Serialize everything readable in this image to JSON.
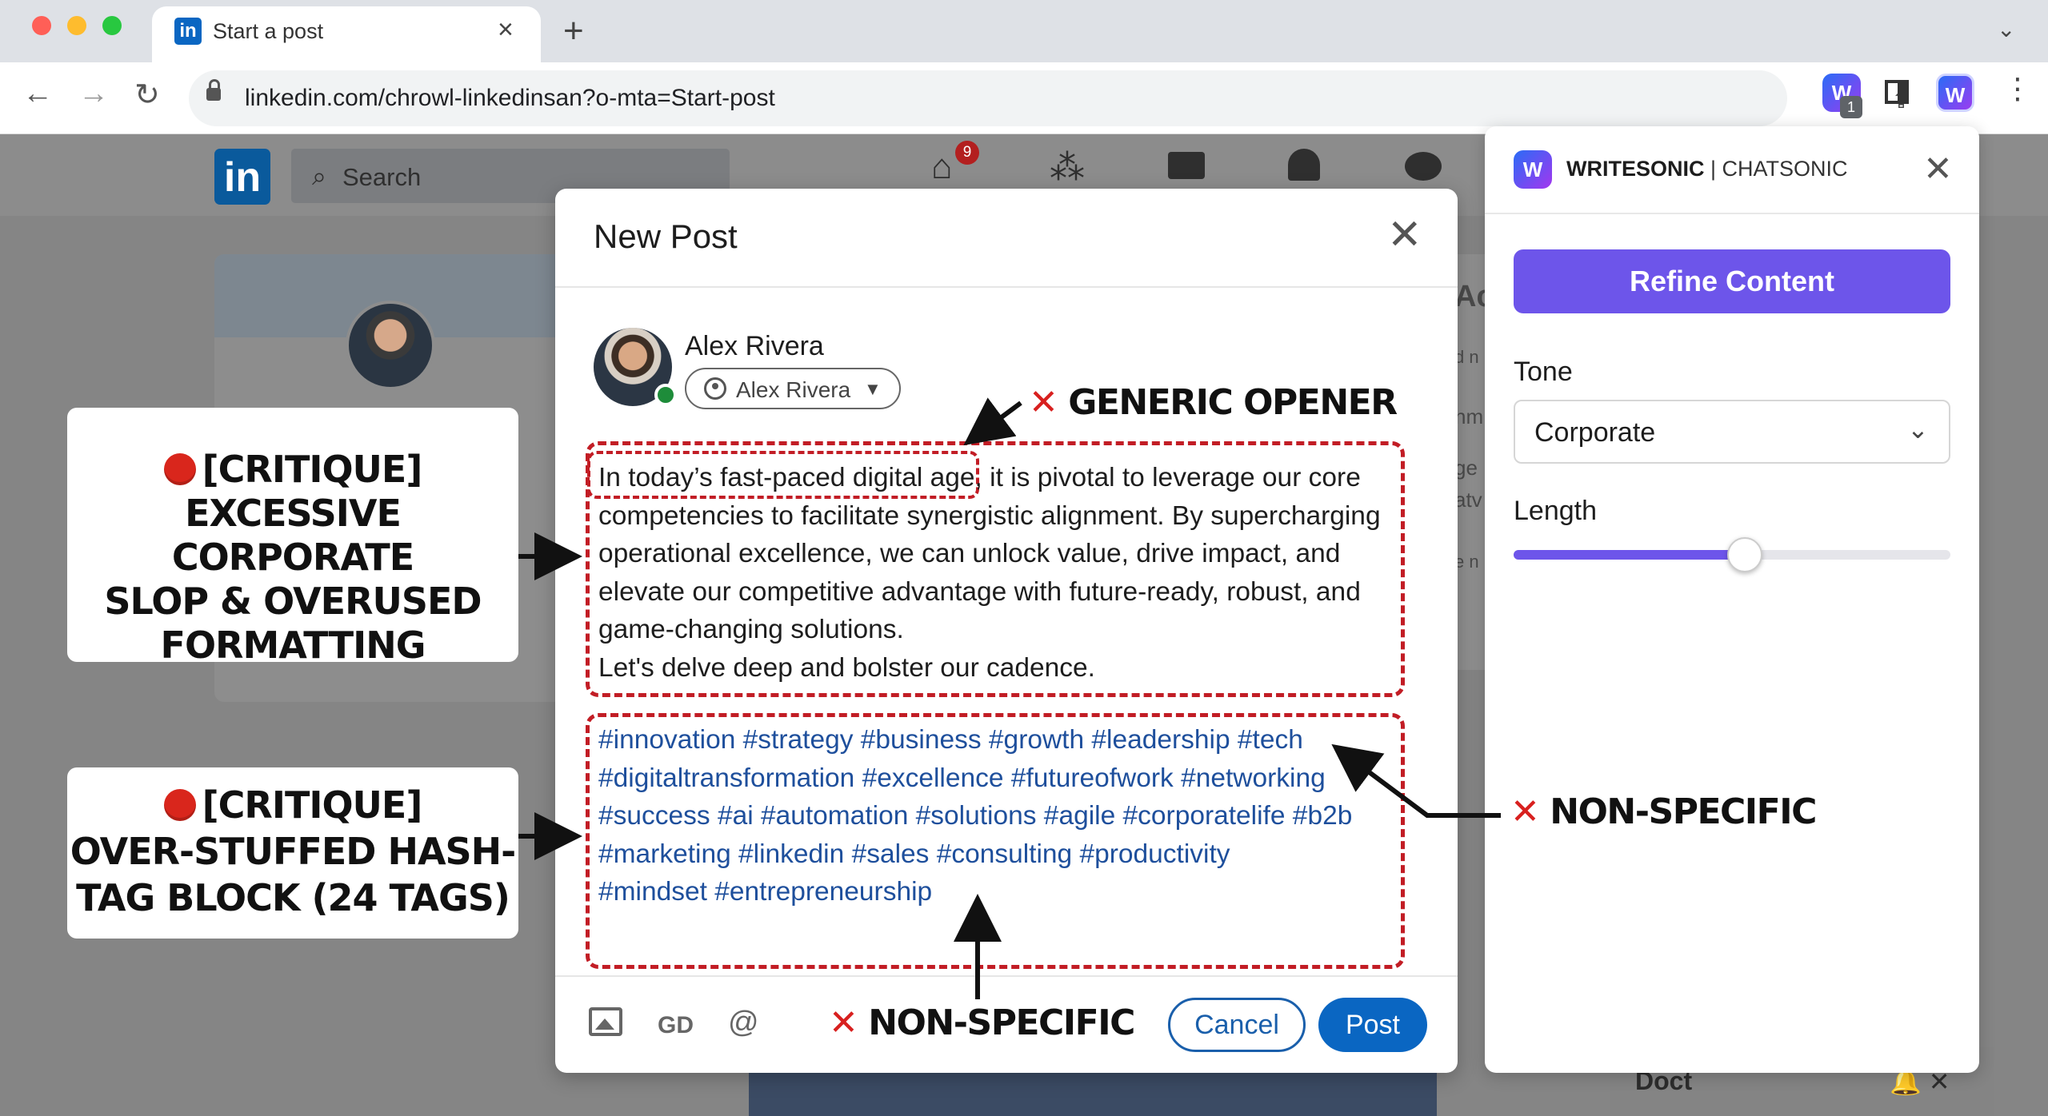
{
  "browser": {
    "tab_title": "Start a post",
    "tab_favicon_text": "in",
    "url": "linkedin.com/chrowl-linkedinsan?o-mta=Start-post",
    "extension_badge": "1",
    "window_controls": [
      "close",
      "minimize",
      "maximize"
    ],
    "colors": {
      "close": "#ff5f57",
      "minimize": "#febc2e",
      "maximize": "#28c840"
    }
  },
  "linkedin": {
    "logo_text": "in",
    "search_placeholder": "Search",
    "home_badge": "9",
    "nav_icons": [
      "home-icon",
      "my-network-icon",
      "jobs-icon",
      "notifications-icon",
      "messaging-icon"
    ],
    "bg_fragments": [
      "Ac",
      "d n",
      "nm",
      "ge",
      "atv",
      "e n"
    ],
    "messaging_title": "Doct"
  },
  "modal": {
    "title": "New Post",
    "author_name": "Alex Rivera",
    "audience_label": "Alex Rivera",
    "body_lines": [
      "In today’s fast-paced digital age, it is pivotal to leverage our core",
      "competencies to facilitate synergistic alignment. By supercharging",
      "operational excellence, we can unlock value, drive impact, and",
      "elevate our competitive advantage with future-ready, robust, and",
      "game-changing solutions.",
      "Let's delve deep and bolster our cadence."
    ],
    "hashtag_lines": [
      "#innovation #strategy #business #growth #leadership #tech",
      "#digitaltransformation #excellence #futureofwork #networking",
      "#success #ai #automation #solutions #agile #corporatelife #b2b",
      "#marketing #linkedin #sales #consulting #productivity",
      "#mindset #entrepreneurship"
    ],
    "cancel_label": "Cancel",
    "post_label": "Post",
    "toolbar_icons": [
      "image-icon",
      "link-icon",
      "mention-icon"
    ],
    "mention_glyph": "@",
    "link_glyph": "GD"
  },
  "writesonic": {
    "logo_text": "W",
    "brand_strong": "WRITESONIC",
    "brand_rest": " | CHATSONIC",
    "refine_label": "Refine Content",
    "tone_label": "Tone",
    "tone_value": "Corporate",
    "length_label": "Length",
    "length_value": 0.53
  },
  "annotations": {
    "callout_1_lines": [
      "[CRITIQUE]",
      "EXCESSIVE CORPORATE",
      "SLOP & OVERUSED",
      "FORMATTING"
    ],
    "callout_2_lines": [
      "[CRITIQUE]",
      "OVER-STUFFED HASH-",
      "TAG BLOCK (24 TAGS)"
    ],
    "label_opener": "GENERIC OPENER",
    "label_nonspecific_right": "NON-SPECIFIC",
    "label_nonspecific_bottom": "NON-SPECIFIC",
    "x_mark": "✕",
    "accent_color": "#c21d25"
  }
}
